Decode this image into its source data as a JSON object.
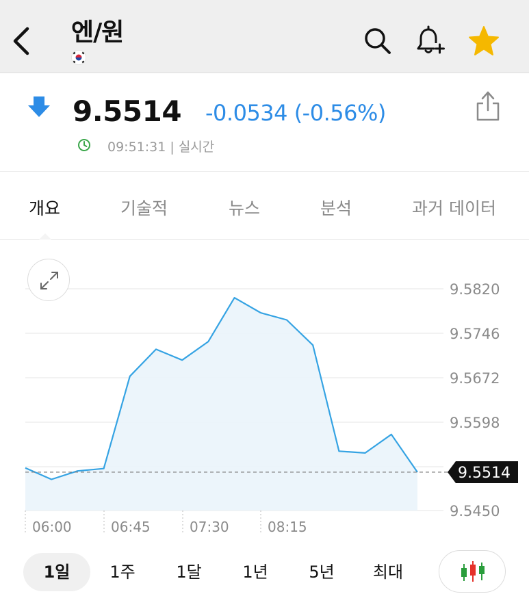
{
  "header": {
    "title": "엔/원",
    "icons": {
      "back": "chevron-left-icon",
      "flag": "korea-flag-icon",
      "search": "search-icon",
      "alert": "bell-plus-icon",
      "favorite": "star-icon"
    },
    "favorite_color": "#f5b800"
  },
  "quote": {
    "price": "9.5514",
    "change": "-0.0534 (-0.56%)",
    "time": "09:51:31 | 실시간",
    "direction": "down",
    "change_color": "#2d8ce6",
    "clock_color": "#3aa64a"
  },
  "tabs": [
    {
      "label": "개요",
      "active": true
    },
    {
      "label": "기술적",
      "active": false
    },
    {
      "label": "뉴스",
      "active": false
    },
    {
      "label": "분석",
      "active": false
    },
    {
      "label": "과거 데이터",
      "active": false
    }
  ],
  "chart_data": {
    "type": "area",
    "x_ticks": [
      "06:00",
      "06:45",
      "07:30",
      "08:15"
    ],
    "y_ticks": [
      "9.5820",
      "9.5746",
      "9.5672",
      "9.5598",
      "9.5450"
    ],
    "ylim": [
      9.545,
      9.582
    ],
    "current_value": "9.5514",
    "series": [
      {
        "values": [
          9.5521,
          9.5502,
          9.5516,
          9.552,
          9.5674,
          9.5719,
          9.5701,
          9.5732,
          9.5805,
          9.578,
          9.5768,
          9.5726,
          9.5549,
          9.5546,
          9.5577,
          9.5514
        ]
      }
    ],
    "line_color": "#35a3e3",
    "fill_color": "#eaf4fb",
    "grid": true
  },
  "periods": [
    {
      "label": "1일",
      "active": true
    },
    {
      "label": "1주",
      "active": false
    },
    {
      "label": "1달",
      "active": false
    },
    {
      "label": "1년",
      "active": false
    },
    {
      "label": "5년",
      "active": false
    },
    {
      "label": "최대",
      "active": false
    }
  ],
  "chart_type_icon": "candlestick-icon"
}
